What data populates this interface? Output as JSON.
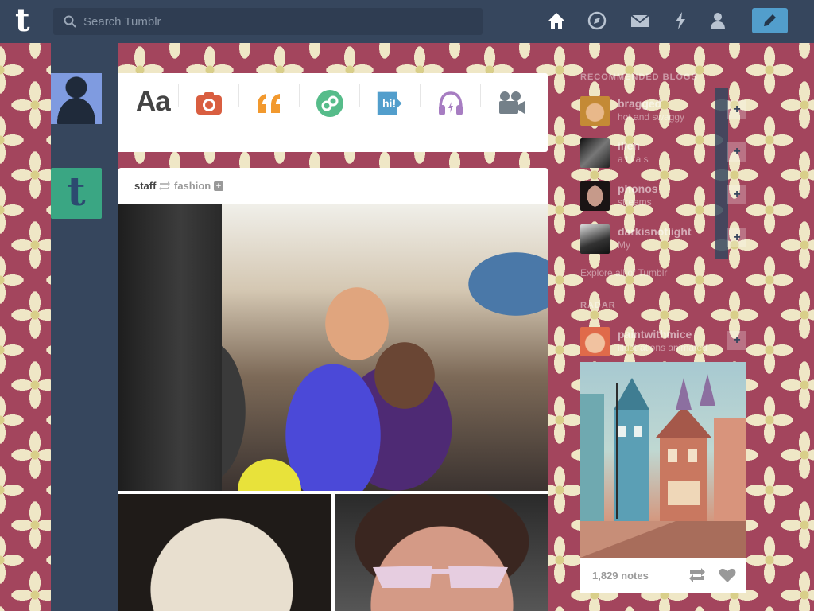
{
  "header": {
    "logo": "t",
    "search_placeholder": "Search Tumblr",
    "nav": [
      "home-icon",
      "explore-icon",
      "inbox-icon",
      "activity-icon",
      "account-icon"
    ],
    "compose": "pencil-icon"
  },
  "post_types": [
    {
      "name": "text",
      "label": "Aa",
      "color": "#444444"
    },
    {
      "name": "photo",
      "icon": "camera-icon",
      "color": "#d95e40"
    },
    {
      "name": "quote",
      "icon": "quote-icon",
      "color": "#f2992e"
    },
    {
      "name": "link",
      "icon": "link-icon",
      "color": "#56bc8a"
    },
    {
      "name": "chat",
      "label": "hi!",
      "color": "#529ecc"
    },
    {
      "name": "audio",
      "icon": "headphones-icon",
      "color": "#a77dc2"
    },
    {
      "name": "video",
      "icon": "video-icon",
      "color": "#748089"
    }
  ],
  "post": {
    "author": "staff",
    "source": "fashion"
  },
  "sidebar": {
    "recommended_title": "RECOMMENDED BLOGS",
    "recommended": [
      {
        "name": "bragged",
        "subtitle": "hot and swaggy"
      },
      {
        "name": "ilien",
        "subtitle": "a t l a s"
      },
      {
        "name": "phonos",
        "subtitle": "streams"
      },
      {
        "name": "darkisnotlight",
        "subtitle": "My"
      }
    ],
    "explore": "Explore all of Tumblr",
    "radar_title": "RADAR",
    "radar": {
      "name": "paintwithmice",
      "subtitle": "illustrations animated",
      "notes": "1,829 notes"
    }
  },
  "colors": {
    "header": "#36465d",
    "accent": "#529ecc",
    "background": "#a3455d"
  }
}
